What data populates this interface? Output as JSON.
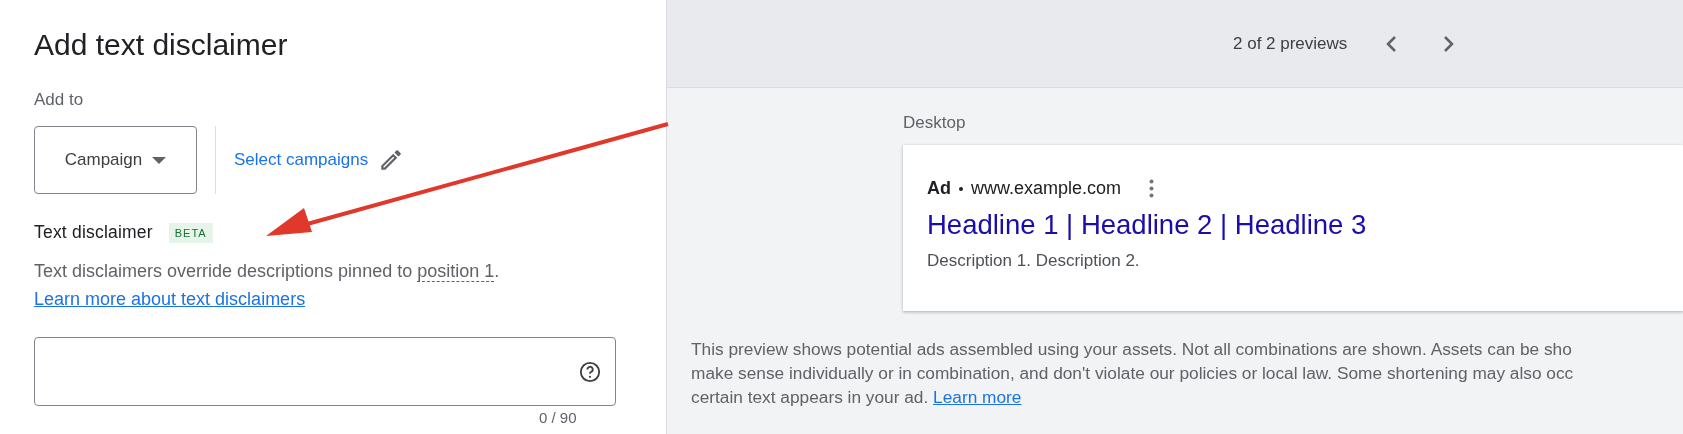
{
  "form": {
    "title": "Add text disclaimer",
    "add_to_label": "Add to",
    "level_dropdown": {
      "value": "Campaign"
    },
    "select_link": "Select campaigns",
    "section_title": "Text disclaimer",
    "badge": "BETA",
    "description": "Text disclaimers override descriptions pinned to ",
    "description_term": "position 1",
    "description_end": ".",
    "learn_link": "Learn more about text disclaimers",
    "counter": "0 / 90"
  },
  "preview": {
    "pager": "2 of 2 previews",
    "device": "Desktop",
    "ad": {
      "label": "Ad",
      "url": "www.example.com",
      "headline": "Headline 1 | Headline 2 | Headline 3",
      "description": "Description 1. Description 2."
    },
    "notice_lines": [
      "This preview shows potential ads assembled using your assets. Not all combinations are shown. Assets can be sho",
      "make sense individually or in combination, and don't violate our policies or local law. Some shortening may also occ",
      "certain text appears in your ad. "
    ],
    "notice_link": "Learn more"
  }
}
